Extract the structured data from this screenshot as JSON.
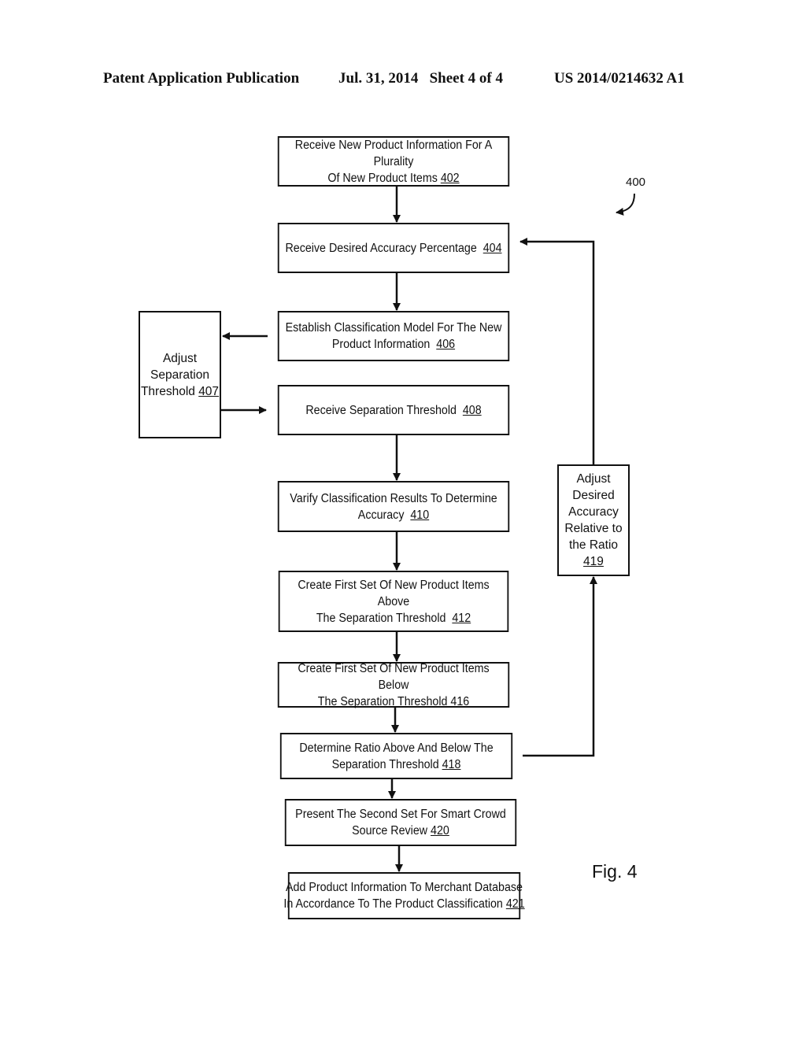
{
  "header": {
    "publication": "Patent Application Publication",
    "date_sheet": "Jul. 31, 2014   Sheet 4 of 4",
    "patent_number": "US 2014/0214632 A1"
  },
  "figure": {
    "label": "Fig. 4",
    "reference_number": "400"
  },
  "steps": {
    "s402": {
      "line1": "Receive New Product Information For A Plurality",
      "line2": "Of New Product Items ",
      "ref": "402"
    },
    "s404": {
      "line1": "Receive Desired Accuracy Percentage  ",
      "ref": "404"
    },
    "s406": {
      "line1": "Establish Classification Model For The New",
      "line2": "Product Information  ",
      "ref": "406"
    },
    "s407": {
      "line1": "Adjust",
      "line2": "Separation",
      "line3": "Threshold ",
      "ref": "407"
    },
    "s408": {
      "line1": "Receive Separation Threshold  ",
      "ref": "408"
    },
    "s410": {
      "line1": "Varify Classification Results To Determine",
      "line2": "Accuracy  ",
      "ref": "410"
    },
    "s412": {
      "line1": "Create First Set Of New Product Items Above",
      "line2": "The Separation Threshold  ",
      "ref": "412"
    },
    "s416": {
      "line1": "Create First Set Of New Product Items Below",
      "line2": "The Separation Threshold ",
      "ref": "416"
    },
    "s418": {
      "line1": "Determine Ratio Above And Below The",
      "line2": "Separation Threshold ",
      "ref": "418"
    },
    "s419": {
      "line1": "Adjust",
      "line2": "Desired",
      "line3": "Accuracy",
      "line4": "Relative to",
      "line5": "the Ratio",
      "ref": "419"
    },
    "s420": {
      "line1": "Present The Second Set For Smart Crowd",
      "line2": "Source Review ",
      "ref": "420"
    },
    "s421": {
      "line1": "Add Product Information To Merchant Database",
      "line2": "In Accordance To The Product Classification ",
      "ref": "421"
    }
  }
}
